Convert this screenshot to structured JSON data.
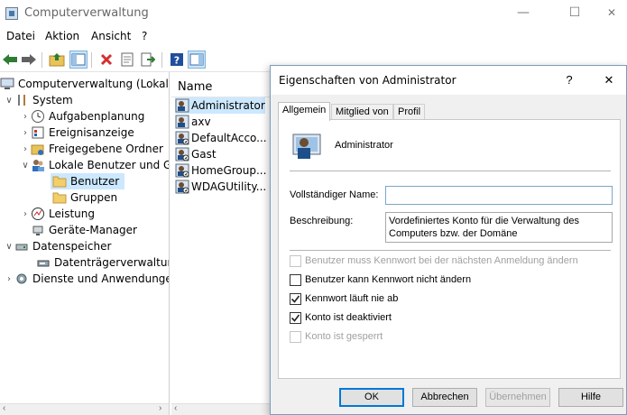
{
  "window": {
    "title": "Computerverwaltung",
    "minimize": "—",
    "maximize": "☐",
    "close": "✕"
  },
  "menu": [
    "Datei",
    "Aktion",
    "Ansicht",
    "?"
  ],
  "toolbar_icons": [
    "back-arrow-icon",
    "forward-arrow-icon",
    "up-folder-icon",
    "show-hide-tree-icon",
    "delete-icon",
    "properties-icon",
    "export-list-icon",
    "help-icon",
    "action-pane-icon"
  ],
  "tree": {
    "root": "Computerverwaltung (Lokal)",
    "system": "System",
    "aufgabenplanung": "Aufgabenplanung",
    "ereignisanzeige": "Ereignisanzeige",
    "freigegebene_ordner": "Freigegebene Ordner",
    "lokale_benutzer": "Lokale Benutzer und Gruppen",
    "benutzer": "Benutzer",
    "gruppen": "Gruppen",
    "leistung": "Leistung",
    "geraete_manager": "Geräte-Manager",
    "datenspeicher": "Datenspeicher",
    "datentraegerverwaltung": "Datenträgerverwaltung",
    "dienste": "Dienste und Anwendungen"
  },
  "list": {
    "column": "Name",
    "users": [
      "Administrator",
      "axv",
      "DefaultAcco...",
      "Gast",
      "HomeGroup...",
      "WDAGUtility..."
    ]
  },
  "dialog": {
    "title": "Eigenschaften von Administrator",
    "help": "?",
    "close": "✕",
    "tabs": [
      "Allgemein",
      "Mitglied von",
      "Profil"
    ],
    "user_name": "Administrator",
    "full_name_label": "Vollständiger Name:",
    "full_name_value": "",
    "description_label": "Beschreibung:",
    "description_value": "Vordefiniertes Konto für die Verwaltung des Computers bzw. der Domäne",
    "checkboxes": [
      {
        "label": "Benutzer muss Kennwort bei der nächsten Anmeldung ändern",
        "checked": false,
        "enabled": false
      },
      {
        "label": "Benutzer kann Kennwort nicht ändern",
        "checked": false,
        "enabled": true
      },
      {
        "label": "Kennwort läuft nie ab",
        "checked": true,
        "enabled": true
      },
      {
        "label": "Konto ist deaktiviert",
        "checked": true,
        "enabled": true
      },
      {
        "label": "Konto ist gesperrt",
        "checked": false,
        "enabled": false
      }
    ],
    "buttons": {
      "ok": "OK",
      "cancel": "Abbrechen",
      "apply": "Übernehmen",
      "help": "Hilfe"
    }
  },
  "colors": {
    "selection": "#cce8ff",
    "accent": "#0078d7"
  }
}
